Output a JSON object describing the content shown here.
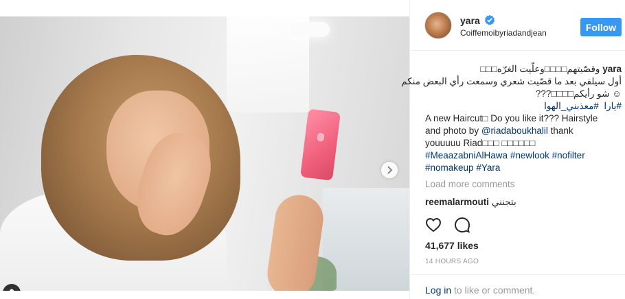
{
  "post": {
    "user": {
      "username": "yara",
      "location": "Coiffemoibyriadandjean",
      "follow_label": "Follow"
    },
    "caption": {
      "user": "yara",
      "arabic_line1": "وقصّيتهم□□□□وعلّيت الغرّه□□□",
      "arabic_line2": "أول سيلفي بعد ما قصّيت شعري وسمعت رأي البعض منكم",
      "arabic_line3": "☺ شو رأيكم□□□□???",
      "hashtags_arabic": [
        "#يارا",
        "#معذبني_الهوا"
      ],
      "english_a": "A new Haircut□ Do you like it??? Hairstyle",
      "english_b": "and photo by",
      "mention": "@riadaboukhalil",
      "english_c": "thank",
      "english_d": "youuuuu Riad□□□ □□□□□□",
      "tags_line1": [
        "#MeaazabniAlHawa",
        "#newlook",
        "#nofilter"
      ],
      "tags_line2": [
        "#nomakeup",
        "#Yara"
      ]
    },
    "load_more": "Load more comments",
    "comment": {
      "user": "reemalarmouti",
      "text": "بتجنني"
    },
    "likes": "41,677 likes",
    "timestamp": "14 HOURS AGO",
    "login": {
      "link": "Log in",
      "rest": "to like or comment."
    },
    "carousel": {
      "count": 4,
      "active_index": 0
    },
    "colors": {
      "follow_bg": "#3897f0",
      "link": "#003569",
      "muted": "#999999",
      "verified": "#3897f0"
    }
  }
}
